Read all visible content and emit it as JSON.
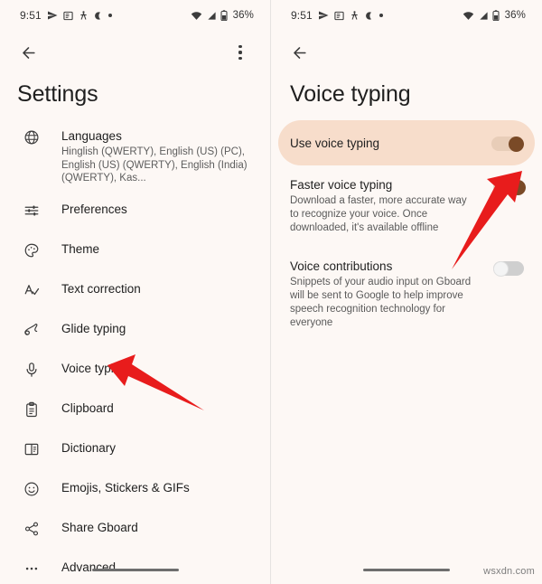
{
  "status_bar": {
    "time": "9:51",
    "left_icons": [
      "send-icon",
      "news-icon",
      "person-walking-icon",
      "crescent-moon-icon",
      "dot-icon"
    ],
    "right_icons": [
      "wifi-icon",
      "signal-icon",
      "battery-icon"
    ],
    "battery": "36%"
  },
  "left_screen": {
    "toolbar": {
      "back_icon": "back-arrow-icon",
      "overflow_icon": "kebab-menu-icon"
    },
    "title": "Settings",
    "items": [
      {
        "icon": "globe-icon",
        "title": "Languages",
        "subtitle": "Hinglish (QWERTY), English (US) (PC), English (US) (QWERTY), English (India) (QWERTY), Kas..."
      },
      {
        "icon": "sliders-icon",
        "title": "Preferences",
        "subtitle": ""
      },
      {
        "icon": "palette-icon",
        "title": "Theme",
        "subtitle": ""
      },
      {
        "icon": "spellcheck-icon",
        "title": "Text correction",
        "subtitle": ""
      },
      {
        "icon": "glide-squiggle-icon",
        "title": "Glide typing",
        "subtitle": ""
      },
      {
        "icon": "microphone-icon",
        "title": "Voice typing",
        "subtitle": ""
      },
      {
        "icon": "clipboard-icon",
        "title": "Clipboard",
        "subtitle": ""
      },
      {
        "icon": "dictionary-book-icon",
        "title": "Dictionary",
        "subtitle": ""
      },
      {
        "icon": "emoji-smiley-icon",
        "title": "Emojis, Stickers & GIFs",
        "subtitle": ""
      },
      {
        "icon": "share-icon",
        "title": "Share Gboard",
        "subtitle": ""
      },
      {
        "icon": "more-horizontal-icon",
        "title": "Advanced",
        "subtitle": ""
      }
    ]
  },
  "right_screen": {
    "toolbar": {
      "back_icon": "back-arrow-icon"
    },
    "title": "Voice typing",
    "preferences": [
      {
        "title": "Use voice typing",
        "subtitle": "",
        "toggle": "on",
        "highlighted": true
      },
      {
        "title": "Faster voice typing",
        "subtitle": "Download a faster, more accurate way to recognize your voice. Once downloaded, it's available offline",
        "toggle": "on",
        "highlighted": false
      },
      {
        "title": "Voice contributions",
        "subtitle": "Snippets of your audio input on Gboard will be sent to Google to help improve speech recognition technology for everyone",
        "toggle": "off",
        "highlighted": false
      }
    ]
  },
  "annotations": {
    "arrow_color": "#e81c1c",
    "left_arrow_target": "Voice typing",
    "right_arrow_target": "Use voice typing toggle"
  },
  "colors": {
    "background": "#fdf8f5",
    "highlight_pill": "#f7ddcb",
    "toggle_on_thumb": "#7a4a27",
    "toggle_on_track": "#e8cdb8",
    "toggle_off_track": "#cfcfcf",
    "text_primary": "#1f1f1f",
    "text_secondary": "#5a5a5a"
  },
  "watermark": "wsxdn.com"
}
